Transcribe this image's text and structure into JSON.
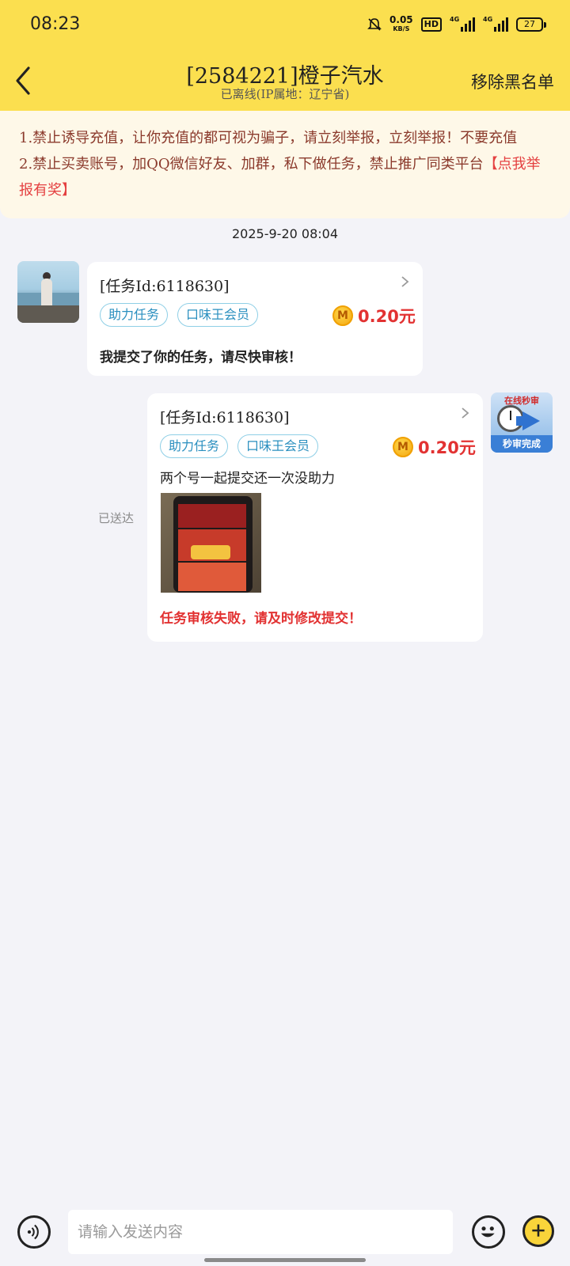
{
  "status_bar": {
    "time": "08:23",
    "net_speed_value": "0.05",
    "net_speed_unit": "KB/S",
    "hd_label": "HD",
    "sim1_label": "4G",
    "sim2_label": "4G",
    "battery": "27"
  },
  "header": {
    "title": "[2584221]橙子汽水",
    "subtitle": "已离线(IP属地：辽宁省)",
    "remove_blacklist": "移除黑名单"
  },
  "notice": {
    "line1": "1.禁止诱导充值，让你充值的都可视为骗子，请立刻举报，立刻举报！不要充值",
    "line2_prefix": "2.禁止买卖账号，加QQ微信好友、加群，私下做任务，禁止推广同类平台",
    "line2_link": "【点我举报有奖】"
  },
  "timestamp": "2025-9-20 08:04",
  "messages": [
    {
      "direction": "incoming",
      "task_id": "[任务Id:6118630]",
      "tags": [
        "助力任务",
        "口味王会员"
      ],
      "coin_symbol": "M",
      "price": "0.20元",
      "text": "我提交了你的任务，请尽快审核！"
    },
    {
      "direction": "outgoing",
      "task_id": "[任务Id:6118630]",
      "tags": [
        "助力任务",
        "口味王会员"
      ],
      "coin_symbol": "M",
      "price": "0.20元",
      "text": "两个号一起提交还一次没助力",
      "status_text": "任务审核失败，请及时修改提交！",
      "delivery": "已送达"
    }
  ],
  "audit_badge": {
    "top": "在线秒审",
    "bottom": "秒审完成"
  },
  "input": {
    "placeholder": "请输入发送内容",
    "value": ""
  },
  "colors": {
    "header_bg": "#fbdf4f",
    "notice_bg": "#fef8e8",
    "accent_red": "#e23232",
    "tag_blue": "#2a8fbf"
  }
}
